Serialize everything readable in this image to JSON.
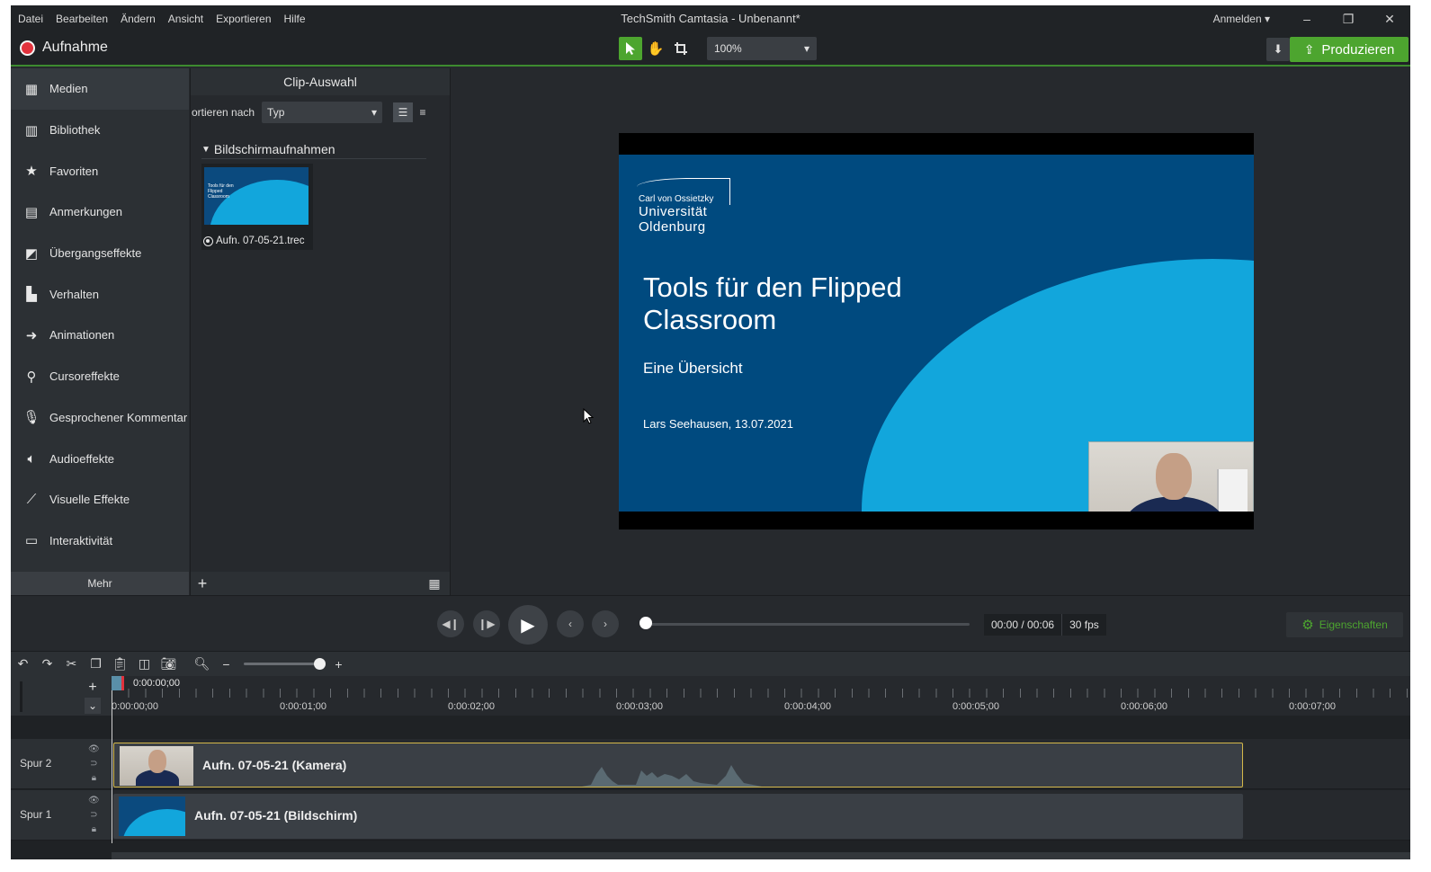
{
  "window": {
    "title": "TechSmith Camtasia - Unbenannt*",
    "signin": "Anmelden ▾",
    "minimize": "–",
    "restore": "❐",
    "close": "✕"
  },
  "menu": [
    "Datei",
    "Bearbeiten",
    "Ändern",
    "Ansicht",
    "Exportieren",
    "Hilfe"
  ],
  "toolbar": {
    "record_label": "Aufnahme",
    "zoom_value": "100%",
    "produce_label": "Produzieren"
  },
  "sidebar": {
    "items": [
      {
        "label": "Medien",
        "icon": "film-icon"
      },
      {
        "label": "Bibliothek",
        "icon": "library-icon"
      },
      {
        "label": "Favoriten",
        "icon": "star-icon"
      },
      {
        "label": "Anmerkungen",
        "icon": "annotation-icon"
      },
      {
        "label": "Übergangseffekte",
        "icon": "transition-icon"
      },
      {
        "label": "Verhalten",
        "icon": "behavior-icon"
      },
      {
        "label": "Animationen",
        "icon": "animation-icon"
      },
      {
        "label": "Cursoreffekte",
        "icon": "cursor-icon"
      },
      {
        "label": "Gesprochener Kommentar",
        "icon": "microphone-icon"
      },
      {
        "label": "Audioeffekte",
        "icon": "speaker-icon"
      },
      {
        "label": "Visuelle Effekte",
        "icon": "wand-icon"
      },
      {
        "label": "Interaktivität",
        "icon": "interactivity-icon"
      }
    ],
    "more_label": "Mehr"
  },
  "clip_panel": {
    "header": "Clip-Auswahl",
    "sort_label": "ortieren nach",
    "sort_value": "Typ",
    "group_label": "Bildschirmaufnahmen",
    "media_label": "Aufn. 07-05-21.trec",
    "thumb_text": "Tools für den Flipped Classroom"
  },
  "slide": {
    "logo_small": "Carl von Ossietzky",
    "logo_line1": "Universität",
    "logo_line2": "Oldenburg",
    "title": "Tools für den Flipped Classroom",
    "subtitle": "Eine Übersicht",
    "author": "Lars Seehausen, 13.07.2021"
  },
  "player": {
    "time": "00:00 / 00:06",
    "fps": "30 fps",
    "properties_label": "Eigenschaften",
    "progress": 0
  },
  "timeline": {
    "playhead_time": "0:00:00;00",
    "ruler_labels": [
      "0:00:00;00",
      "0:00:01;00",
      "0:00:02;00",
      "0:00:03;00",
      "0:00:04;00",
      "0:00:05;00",
      "0:00:06;00",
      "0:00:07;00"
    ],
    "tracks": [
      {
        "name": "Spur 2",
        "clip": "Aufn. 07-05-21 (Kamera)"
      },
      {
        "name": "Spur 1",
        "clip": "Aufn. 07-05-21 (Bildschirm)"
      }
    ]
  },
  "colors": {
    "accent": "#4da52f",
    "record": "#e2323d",
    "slide_bg": "#004a7f",
    "slide_arc": "#12a6dc",
    "selected_clip_border": "#d4b84a"
  }
}
